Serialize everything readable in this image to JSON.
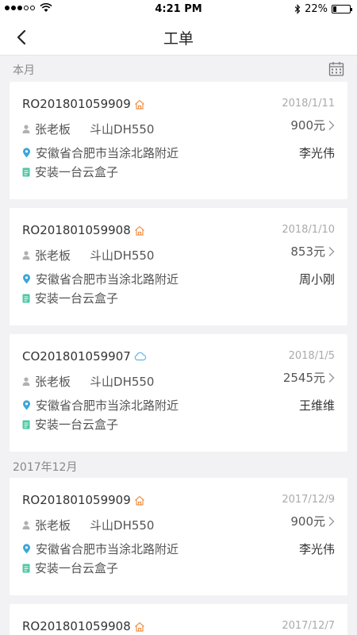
{
  "status_bar": {
    "time": "4:21 PM",
    "battery": "22%",
    "battery_level": 0.22
  },
  "header": {
    "title": "工单"
  },
  "sections": [
    {
      "title": "本月"
    },
    {
      "title": "2017年12月"
    }
  ],
  "orders": [
    {
      "number": "RO201801059909",
      "type_icon": "home-icon",
      "date": "2018/1/11",
      "customer": "张老板",
      "device": "斗山DH550",
      "price": "900元",
      "address": "安徽省合肥市当涂北路附近",
      "staff": "李光伟",
      "task": "安装一台云盒子"
    },
    {
      "number": "RO201801059908",
      "type_icon": "home-icon",
      "date": "2018/1/10",
      "customer": "张老板",
      "device": "斗山DH550",
      "price": "853元",
      "address": "安徽省合肥市当涂北路附近",
      "staff": "周小刚",
      "task": "安装一台云盒子"
    },
    {
      "number": "CO201801059907",
      "type_icon": "cloud-icon",
      "date": "2018/1/5",
      "customer": "张老板",
      "device": "斗山DH550",
      "price": "2545元",
      "address": "安徽省合肥市当涂北路附近",
      "staff": "王维维",
      "task": "安装一台云盒子"
    },
    {
      "number": "RO201801059909",
      "type_icon": "home-icon",
      "date": "2017/12/9",
      "customer": "张老板",
      "device": "斗山DH550",
      "price": "900元",
      "address": "安徽省合肥市当涂北路附近",
      "staff": "李光伟",
      "task": "安装一台云盒子"
    },
    {
      "number": "RO201801059908",
      "type_icon": "home-icon",
      "date": "2017/12/7"
    }
  ],
  "colors": {
    "home_icon": "#f0924a",
    "cloud_icon": "#5bb7e6",
    "location_icon": "#3aa7d9",
    "task_icon": "#4cc9a4",
    "person_icon": "#b0b0b0"
  }
}
